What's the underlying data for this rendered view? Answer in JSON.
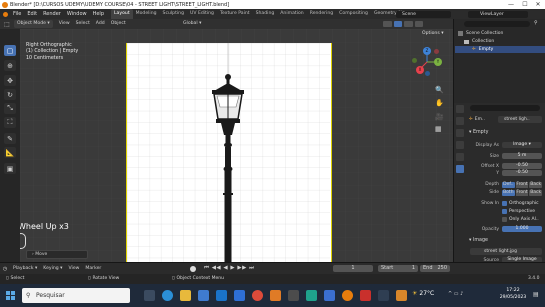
{
  "window": {
    "title": "Blender* [D:\\CURSOS UDEMY\\UDEMY COURSE\\04 - STREET LIGHT\\STREET_LIGHT.blend]",
    "controls": [
      "—",
      "☐",
      "✕"
    ]
  },
  "menu": {
    "items": [
      "File",
      "Edit",
      "Render",
      "Window",
      "Help"
    ],
    "workspaces": [
      "Layout",
      "Modeling",
      "Sculpting",
      "UV Editing",
      "Texture Paint",
      "Shading",
      "Animation",
      "Rendering",
      "Compositing",
      "Geometry No"
    ],
    "active_workspace": "Layout",
    "scene": "Scene",
    "view_layer": "ViewLayer"
  },
  "viewport_header": {
    "mode": "Object Mode",
    "items": [
      "View",
      "Select",
      "Add",
      "Object"
    ],
    "orientation": "Global",
    "options": "Options"
  },
  "view_info": {
    "line1": "Right Orthographic",
    "line2": "(1) Collection | Empty",
    "line3": "10 Centimeters"
  },
  "operator": {
    "wheel_text": "Wheel Up x3",
    "move_label": "Move"
  },
  "gizmo": {
    "x": "X",
    "y": "Y",
    "z": "Z",
    "colors": {
      "x": "#e8414c",
      "y": "#7bb241",
      "z": "#3d82d8"
    }
  },
  "outliner": {
    "rows": [
      "Scene Collection",
      "Collection",
      "Empty"
    ],
    "search_placeholder": ""
  },
  "properties": {
    "object_name": "Em..",
    "data_name": "street ligh..",
    "section": "Empty",
    "display_as_label": "Display As",
    "display_as_value": "Image",
    "size_label": "Size",
    "size_value": "5 m",
    "offset_x_label": "Offset X",
    "offset_x_value": "-0.50",
    "offset_y_label": "Y",
    "offset_y_value": "-0.50",
    "depth_label": "Depth",
    "depth_options": [
      "Def..",
      "Front",
      "Back"
    ],
    "side_label": "Side",
    "side_options": [
      "Both",
      "Front",
      "Back"
    ],
    "show_in_label": "Show In",
    "show_orthographic": "Orthographic",
    "show_perspective": "Perspective",
    "only_axis": "Only Axis Al..",
    "opacity_label": "Opacity",
    "opacity_value": "1.000",
    "image_section": "Image",
    "image_name": "street light.jpg",
    "source_label": "Source",
    "source_value": "Single Image",
    "file_path": "\\\\UDEMY\\UDEMY COURSE\\04 -"
  },
  "timeline": {
    "playback": "Playback",
    "keying": "Keying",
    "view": "View",
    "marker": "Marker",
    "current_frame": "1",
    "start_label": "Start",
    "start_value": "1",
    "end_label": "End",
    "end_value": "250"
  },
  "statusbar": {
    "select": "Select",
    "rotate": "Rotate View",
    "context": "Object Context Menu",
    "version": "3.4.0"
  },
  "taskbar": {
    "search_placeholder": "Pesquisar",
    "temperature": "27°C",
    "time": "17:22",
    "date": "29/05/2023"
  },
  "accent": "#4772b3"
}
